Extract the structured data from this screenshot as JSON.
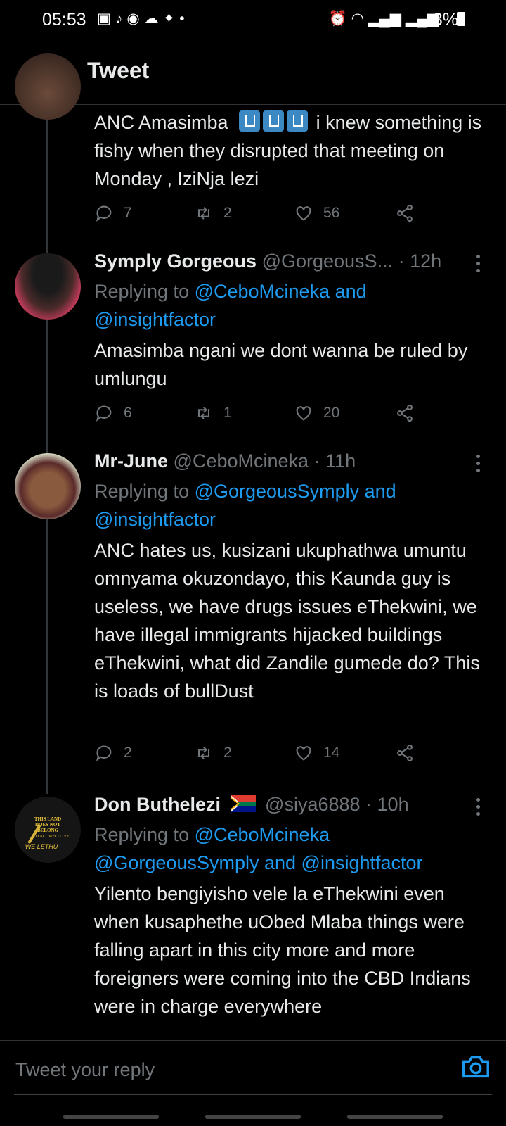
{
  "status_bar": {
    "time": "05:53",
    "battery": "3%",
    "left_icons": [
      "s-icon",
      "bell-icon",
      "messenger-icon",
      "cloud-icon",
      "twitter-icon"
    ],
    "right_icons": [
      "alarm-icon",
      "wifi-icon",
      "signal-icon",
      "signal-icon"
    ]
  },
  "header": {
    "title": "Tweet"
  },
  "tweets": [
    {
      "body_before": "ANC Amasimba",
      "body_after": " i knew something is fishy when they disrupted that meeting on Monday , IziNja lezi",
      "stats": {
        "replies": "7",
        "retweets": "2",
        "likes": "56"
      }
    },
    {
      "name": "Symply Gorgeous",
      "handle": "@GorgeousS...",
      "time": "· 12h",
      "reply_prefix": "Replying to ",
      "reply_links": "@CeboMcineka and @insightfactor",
      "body": "Amasimba ngani we dont wanna be ruled by umlungu",
      "stats": {
        "replies": "6",
        "retweets": "1",
        "likes": "20"
      }
    },
    {
      "name": "Mr-June",
      "handle": "@CeboMcineka",
      "time": "· 11h",
      "reply_prefix": "Replying to ",
      "reply_links": "@GorgeousSymply and @insightfactor",
      "body": "ANC hates us, kusizani ukuphathwa umuntu omnyama okuzondayo, this Kaunda guy is useless, we have drugs issues eThekwini, we have illegal immigrants hijacked buildings eThekwini, what did Zandile gumede do? This is loads of bullDust",
      "stats": {
        "replies": "2",
        "retweets": "2",
        "likes": "14"
      }
    },
    {
      "name": "Don Buthelezi",
      "handle": "@siya6888",
      "time": "· 10h",
      "reply_prefix": "Replying to ",
      "reply_links": "@CeboMcineka @GorgeousSymply and @insightfactor",
      "body": "Yilento bengiyisho vele la eThekwini even when kusaphethe uObed Mlaba things were falling apart in this city more and more foreigners were coming into the CBD Indians were in charge everywhere",
      "avatar_text": "THIS LAND DOES NOT BELONG TO ALL WHO LIVE IN IT WE LETHU"
    }
  ],
  "reply_bar": {
    "placeholder": "Tweet your reply"
  }
}
